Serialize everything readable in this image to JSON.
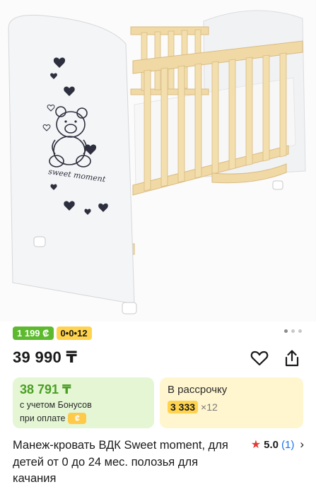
{
  "badges": {
    "bonus": "1 199 ₡",
    "installment": "0•0•12"
  },
  "gallery": {
    "pages": 3,
    "active_index": 0
  },
  "product": {
    "price": "39 990 ₸",
    "title": "Манеж-кровать ВДК Sweet moment, для детей от 0 до 24 мес. полозья для качания",
    "image_text": "sweet moment"
  },
  "bonus_card": {
    "price": "38 791 ₸",
    "line1": "с учетом Бонусов",
    "line2": "при оплате",
    "chip": "₡"
  },
  "installment_card": {
    "title": "В рассрочку",
    "amount": "3 333",
    "months": "×12"
  },
  "rating": {
    "score": "5.0",
    "reviews": "(1)"
  },
  "icons": {
    "favorite": "heart-outline-icon",
    "share": "share-icon",
    "star": "star-icon",
    "chevron": "chevron-right-icon"
  },
  "colors": {
    "bonus_green": "#5dba2f",
    "install_yellow": "#ffd34d",
    "star_red": "#e53935",
    "link_blue": "#1a73e8"
  }
}
